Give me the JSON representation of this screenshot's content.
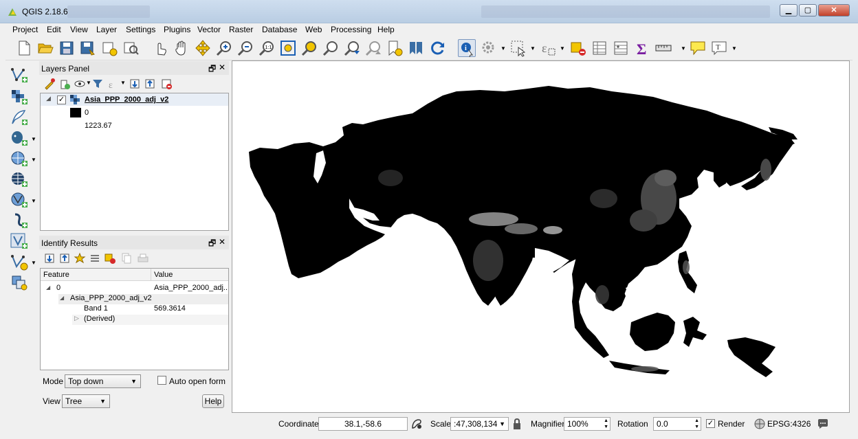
{
  "window": {
    "title": "QGIS 2.18.6",
    "minimize_glyph": "▁",
    "maximize_glyph": "▢",
    "close_glyph": "✕"
  },
  "menu": [
    "Project",
    "Edit",
    "View",
    "Layer",
    "Settings",
    "Plugins",
    "Vector",
    "Raster",
    "Database",
    "Web",
    "Processing",
    "Help"
  ],
  "toolbar": {
    "icons": [
      "new-project-icon",
      "open-project-icon",
      "save-project-icon",
      "save-as-icon",
      "new-print-composer-icon",
      "composer-manager-icon",
      "touch-zoom-icon",
      "pan-map-icon",
      "pan-to-selection-icon",
      "zoom-in-icon",
      "zoom-out-icon",
      "zoom-native-icon",
      "zoom-full-icon",
      "zoom-to-selection-icon",
      "zoom-to-layer-icon",
      "zoom-last-icon",
      "zoom-next-icon",
      "new-bookmark-icon",
      "show-bookmarks-icon",
      "refresh-icon",
      "identify-icon",
      "action-icon",
      "select-features-icon",
      "select-by-expression-icon",
      "deselect-icon",
      "open-attribute-table-icon",
      "open-field-calculator-icon",
      "statistics-icon",
      "measure-icon",
      "map-tips-icon",
      "text-annotation-icon"
    ]
  },
  "left_tools": [
    "add-vector-layer-icon",
    "add-raster-layer-icon",
    "add-delimited-text-icon",
    "add-postgis-layer-icon",
    "add-wms-layer-icon",
    "add-wcs-layer-icon",
    "add-wfs-layer-icon",
    "add-spatialite-icon",
    "add-virtual-layer-icon",
    "new-shapefile-icon",
    "new-geopackage-icon"
  ],
  "layers_panel": {
    "title": "Layers Panel",
    "float_glyph": "🗗",
    "close_glyph": "✕",
    "layer_name": "Asia_PPP_2000_adj_v2",
    "legend_min": "0",
    "legend_max": "1223.67"
  },
  "identify_panel": {
    "title": "Identify Results",
    "float_glyph": "🗗",
    "close_glyph": "✕",
    "columns": [
      "Feature",
      "Value"
    ],
    "rows": [
      {
        "feature": "0",
        "value": "Asia_PPP_2000_adj..."
      },
      {
        "feature": "Asia_PPP_2000_adj_v2",
        "value": ""
      },
      {
        "feature": "Band 1",
        "value": "569.3614"
      },
      {
        "feature": "(Derived)",
        "value": ""
      }
    ],
    "mode_label": "Mode",
    "mode_value": "Top down",
    "auto_open_label": "Auto open form",
    "view_label": "View",
    "view_value": "Tree",
    "help_label": "Help"
  },
  "statusbar": {
    "coordinate_label": "Coordinate",
    "coordinate_value": "38.1,-58.6",
    "scale_label": "Scale",
    "scale_value": ":47,308,134",
    "magnifier_label": "Magnifier",
    "magnifier_value": "100%",
    "rotation_label": "Rotation",
    "rotation_value": "0.0",
    "render_label": "Render",
    "crs_label": "EPSG:4326"
  },
  "colors": {
    "accent": "#3a6ea5",
    "map_land": "#000000",
    "map_background": "#ffffff"
  }
}
